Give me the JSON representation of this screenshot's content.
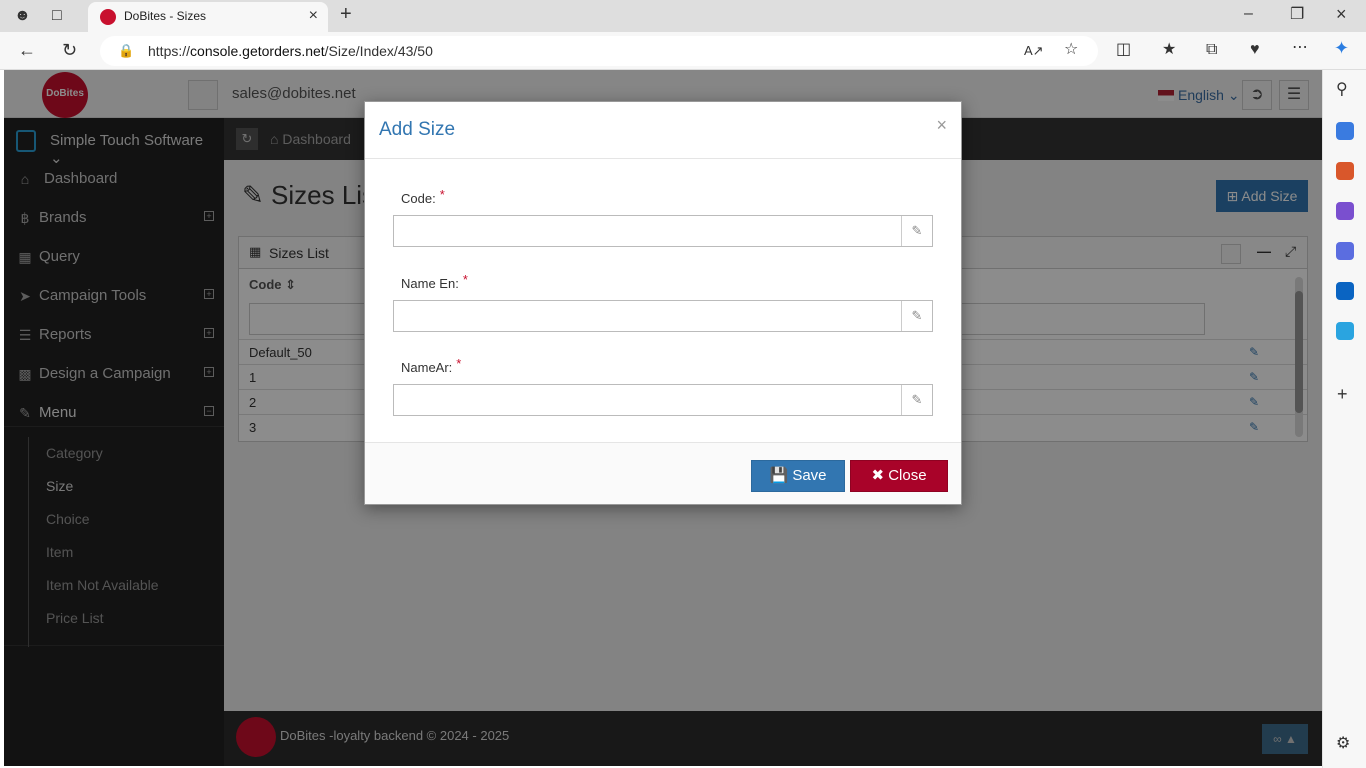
{
  "browser": {
    "tab_title": "DoBites - Sizes",
    "url_prefix": "https://",
    "url_host": "console.getorders.net",
    "url_path": "/Size/Index/43/50"
  },
  "topbar": {
    "logo_text": "DoBites",
    "user_email": "sales@dobites.net",
    "language": "English"
  },
  "sidebar": {
    "org_name": "Simple Touch Software",
    "items": [
      {
        "label": "Dashboard",
        "icon": "home-icon"
      },
      {
        "label": "Brands",
        "icon": "bitcoin-icon"
      },
      {
        "label": "Query",
        "icon": "puzzle-icon"
      },
      {
        "label": "Campaign Tools",
        "icon": "send-icon"
      },
      {
        "label": "Reports",
        "icon": "database-icon"
      },
      {
        "label": "Design a Campaign",
        "icon": "briefcase-icon"
      },
      {
        "label": "Menu",
        "icon": "edit-icon"
      }
    ],
    "menu_subitems": [
      "Category",
      "Size",
      "Choice",
      "Item",
      "Item Not Available",
      "Price List"
    ]
  },
  "content": {
    "breadcrumb": "Dashboard",
    "page_title": "Sizes List",
    "add_button": "Add Size",
    "widget_title": "Sizes List",
    "column_code": "Code",
    "rows": [
      "Default_50",
      "1",
      "2",
      "3"
    ]
  },
  "footer": {
    "text": "DoBites -loyalty backend © 2024 - 2025"
  },
  "modal": {
    "title": "Add Size",
    "fields": [
      {
        "label": "Code:",
        "value": "",
        "placeholder": ""
      },
      {
        "label": "Name En:",
        "value": "",
        "placeholder": ""
      },
      {
        "label": "NameAr:",
        "value": "",
        "placeholder": ""
      }
    ],
    "required_mark": "*",
    "save_label": "Save",
    "close_label": "Close"
  },
  "colors": {
    "primary": "#3276b1",
    "danger": "#a90329",
    "brand": "#c8102e"
  }
}
